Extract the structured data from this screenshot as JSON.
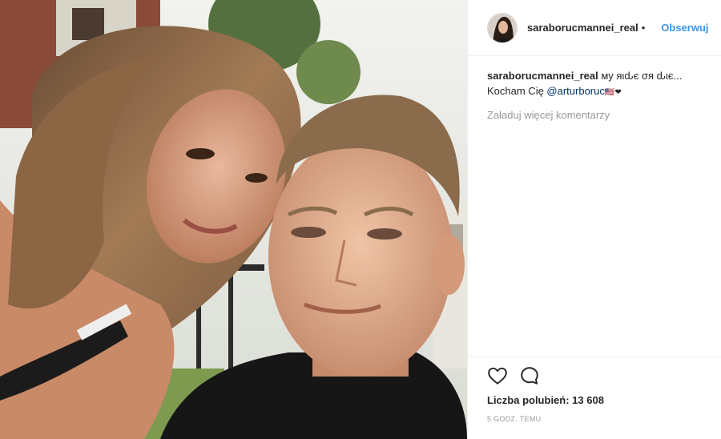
{
  "post": {
    "username": "saraborucmannei_real",
    "dot": "•",
    "follow_label": "Obserwuj",
    "caption_author": "saraborucmannei_real",
    "caption_text": " мy яιԃє σя ԃιє...",
    "caption_line2_prefix": "Kocham Cię ",
    "caption_mention": "@arturboruc",
    "caption_emoji": "🇺🇸❤",
    "load_more": "Załaduj więcej komentarzy",
    "likes": "Liczba polubień: 13 608",
    "time": "5 GODZ. TEMU"
  },
  "icons": {
    "like": "heart-icon",
    "comment": "comment-icon"
  },
  "colors": {
    "accent": "#3897f0",
    "text": "#262626",
    "muted": "#999999",
    "mention": "#003569"
  }
}
